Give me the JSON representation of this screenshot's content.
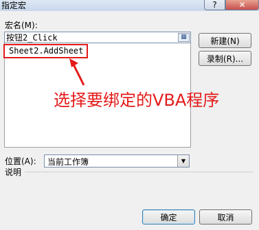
{
  "window": {
    "title": "指定宏",
    "help_glyph": "?",
    "close_glyph": "✕"
  },
  "macro_name": {
    "label": "宏名(M):",
    "value": "按钮2_Click",
    "pick_icon": "range-picker-icon"
  },
  "macro_list": {
    "items": [
      "Sheet2.AddSheet"
    ]
  },
  "buttons": {
    "new": "新建(N)",
    "record": "录制(R)...",
    "ok": "确定",
    "cancel": "取消"
  },
  "location": {
    "label": "位置(A):",
    "value": "当前工作簿"
  },
  "description": {
    "label": "说明"
  },
  "annotation": {
    "text": "选择要绑定的VBA程序",
    "color": "#e41a1a"
  }
}
